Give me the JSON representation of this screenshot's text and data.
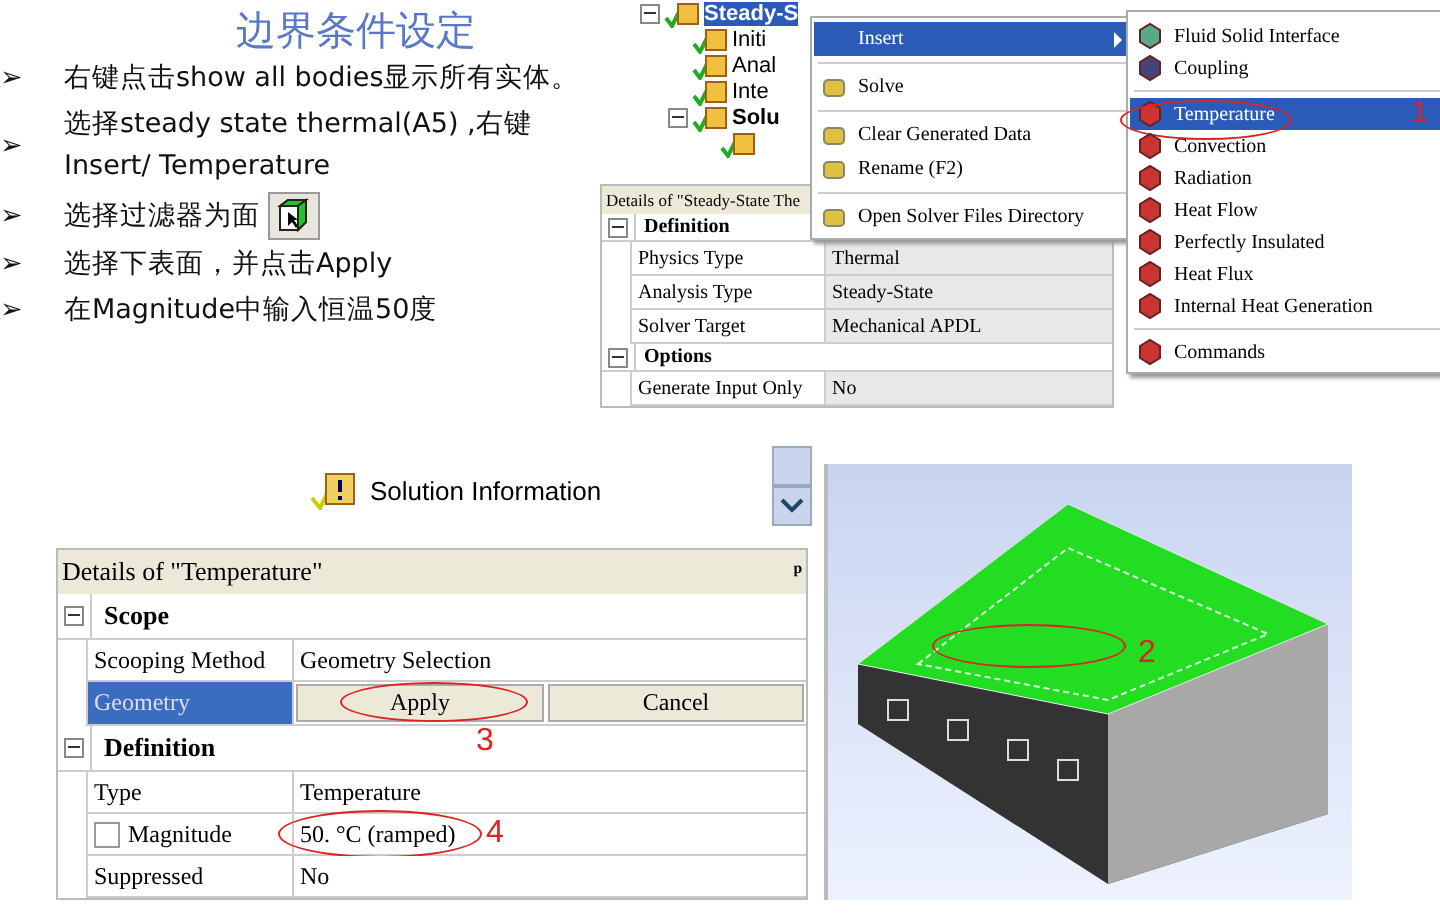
{
  "slide": {
    "title": "边界条件设定",
    "bullets": [
      {
        "marker": "➢",
        "text": "右键点击show all bodies显示所有实体。",
        "has_filter_icon": false
      },
      {
        "marker": "➢",
        "text": "选择steady state thermal(A5) ,右键Insert/ Temperature",
        "has_filter_icon": false
      },
      {
        "marker": "➢",
        "text": "选择过滤器为面",
        "has_filter_icon": true
      },
      {
        "marker": "➢",
        "text": "选择下表面，并点击Apply",
        "has_filter_icon": false
      },
      {
        "marker": "➢",
        "text": "在Magnitude中输入恒温50度",
        "has_filter_icon": false
      }
    ]
  },
  "top_tree": {
    "items": [
      {
        "label": "Steady-S",
        "selected": true,
        "bold": true,
        "expanded": true,
        "children": [
          {
            "label": "Initi",
            "selected": false,
            "bold": false
          },
          {
            "label": "Anal",
            "selected": false,
            "bold": false
          },
          {
            "label": "Inte",
            "selected": false,
            "bold": false
          },
          {
            "label": "Solu",
            "selected": false,
            "bold": true,
            "expanded": true,
            "children": [
              {
                "selected": false
              }
            ]
          }
        ]
      }
    ]
  },
  "top_details": {
    "title": "Details of \"Steady-State The",
    "groups": [
      {
        "name": "Definition",
        "expanded": true,
        "rows": [
          {
            "label": "Physics Type",
            "value": "Thermal"
          },
          {
            "label": "Analysis Type",
            "value": "Steady-State"
          },
          {
            "label": "Solver Target",
            "value": "Mechanical APDL"
          }
        ]
      },
      {
        "name": "Options",
        "expanded": true,
        "rows": [
          {
            "label": "Generate Input Only",
            "value": "No"
          }
        ]
      }
    ]
  },
  "context_menu": {
    "items": [
      {
        "kind": "submenu",
        "label": "Insert",
        "selected": true
      },
      {
        "kind": "separator"
      },
      {
        "kind": "item",
        "label": "Solve",
        "selected": false
      },
      {
        "kind": "separator"
      },
      {
        "kind": "item",
        "label": "Clear Generated Data",
        "selected": false
      },
      {
        "kind": "item",
        "label": "Rename (F2)",
        "selected": false
      },
      {
        "kind": "separator"
      },
      {
        "kind": "item",
        "label": "Open Solver Files Directory",
        "selected": false
      }
    ]
  },
  "submenu": {
    "items": [
      {
        "kind": "item",
        "label": "Fluid Solid Interface",
        "selected": false
      },
      {
        "kind": "item",
        "label": "Coupling",
        "selected": false
      },
      {
        "kind": "separator"
      },
      {
        "kind": "item",
        "label": "Temperature",
        "selected": true,
        "callout": "1"
      },
      {
        "kind": "item",
        "label": "Convection",
        "selected": false
      },
      {
        "kind": "item",
        "label": "Radiation",
        "selected": false
      },
      {
        "kind": "item",
        "label": "Heat Flow",
        "selected": false
      },
      {
        "kind": "item",
        "label": "Perfectly Insulated",
        "selected": false
      },
      {
        "kind": "item",
        "label": "Heat Flux",
        "selected": false
      },
      {
        "kind": "item",
        "label": "Internal Heat Generation",
        "selected": false
      },
      {
        "kind": "separator"
      },
      {
        "kind": "item",
        "label": "Commands",
        "selected": false
      }
    ]
  },
  "bottom_tree": {
    "items": [
      {
        "label": "Solution Information"
      }
    ]
  },
  "bottom_details": {
    "title": "Details of \"Temperature\"",
    "pin": "ᵖ",
    "groups": [
      {
        "name": "Scope",
        "expanded": true,
        "rows": [
          {
            "kind": "text",
            "label": "Scooping Method",
            "value": "Geometry Selection",
            "selected": false
          },
          {
            "kind": "buttons",
            "label": "Geometry",
            "buttons": [
              {
                "label": "Apply",
                "callout": "3"
              },
              {
                "label": "Cancel"
              }
            ],
            "selected": true
          }
        ]
      },
      {
        "name": "Definition",
        "expanded": true,
        "rows": [
          {
            "kind": "text",
            "label": "Type",
            "value": "Temperature",
            "selected": false
          },
          {
            "kind": "checkbox",
            "label": "Magnitude",
            "value": "50. °C  (ramped)",
            "checked": false,
            "selected": false,
            "callout": "4"
          },
          {
            "kind": "text",
            "label": "Suppressed",
            "value": "No",
            "selected": false
          }
        ]
      }
    ]
  },
  "model_view": {
    "callout": "2"
  }
}
